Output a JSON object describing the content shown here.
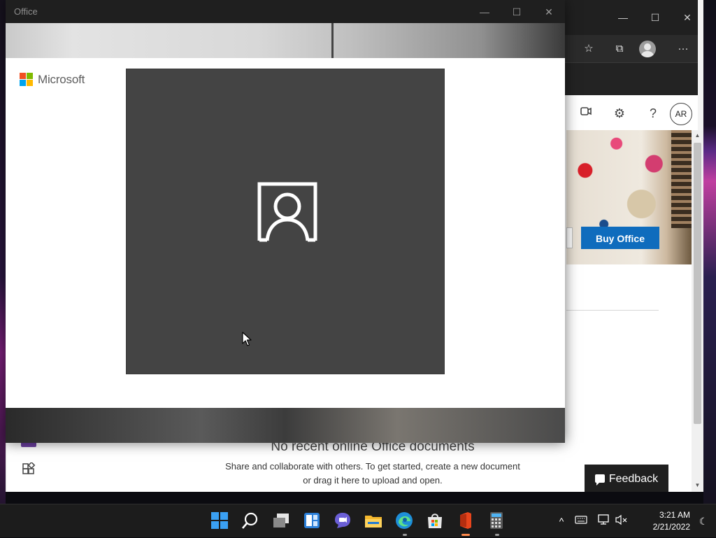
{
  "office_window": {
    "title": "Office",
    "brand": "Microsoft"
  },
  "browser": {
    "user_initials": "AR",
    "buy_button": "Buy Office",
    "empty_state": {
      "title": "No recent online Office documents",
      "description": "Share and collaborate with others. To get started, create a new document or drag it here to upload and open."
    },
    "feedback_button": "Feedback"
  },
  "taskbar": {
    "apps": [
      "start-icon",
      "search-icon",
      "task-view-icon",
      "widgets-icon",
      "chat-icon",
      "file-explorer-icon",
      "edge-icon",
      "store-icon",
      "office-icon",
      "calculator-icon"
    ],
    "clock": {
      "time": "3:21 AM",
      "date": "2/21/2022"
    }
  },
  "colors": {
    "accent": "#0f6cbd",
    "ms_red": "#f25022",
    "ms_green": "#7fba00",
    "ms_blue": "#00a4ef",
    "ms_yellow": "#ffb900"
  }
}
